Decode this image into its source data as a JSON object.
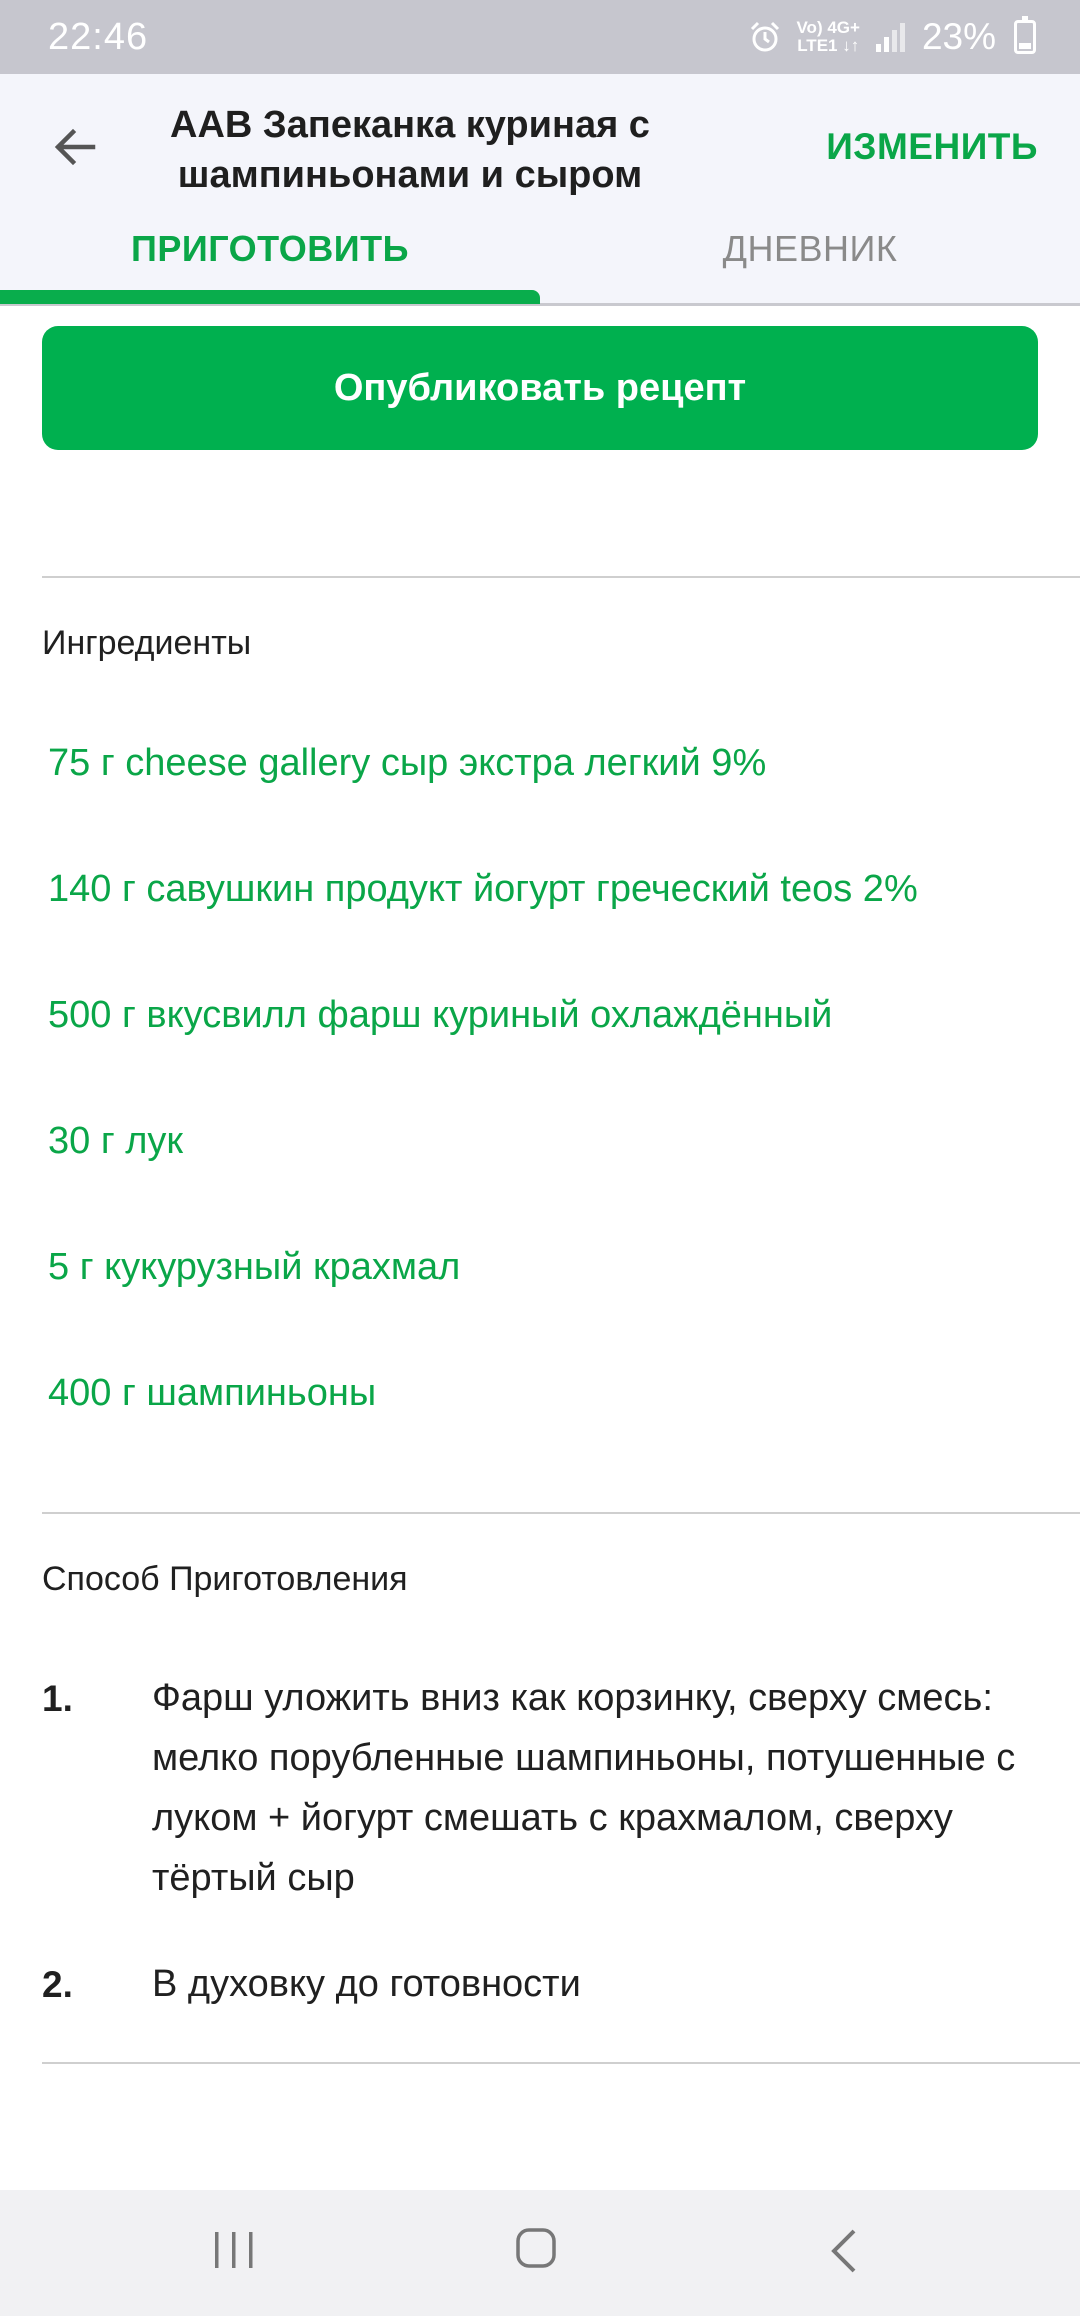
{
  "status_bar": {
    "time": "22:46",
    "net_line1": "Vo) 4G+",
    "net_line2": "LTE1 ↓↑",
    "battery": "23%"
  },
  "header": {
    "title": "AAB Запеканка куриная с шампиньонами и сыром",
    "edit_label": "ИЗМЕНИТЬ",
    "tabs": [
      {
        "label": "ПРИГОТОВИТЬ",
        "active": true
      },
      {
        "label": "ДНЕВНИК",
        "active": false
      }
    ]
  },
  "publish_label": "Опубликовать рецепт",
  "ingredients": {
    "title": "Ингредиенты",
    "items": [
      "75 г cheese gallery сыр экстра легкий 9%",
      "140 г савушкин продукт йогурт греческий teos 2%",
      "500 г вкусвилл фарш куриный охлаждённый",
      "30 г лук",
      "5 г кукурузный крахмал",
      "400 г шампиньоны"
    ]
  },
  "method": {
    "title": "Способ Приготовления",
    "steps": [
      {
        "num": "1.",
        "text": "Фарш уложить вниз как корзинку, сверху смесь: мелко порубленные шампиньоны, потушенные с луком + йогурт смешать с крахмалом, сверху тёртый сыр"
      },
      {
        "num": "2.",
        "text": "В духовку до готовности"
      }
    ]
  },
  "colors": {
    "accent": "#0aa648",
    "button": "#00b04f"
  }
}
